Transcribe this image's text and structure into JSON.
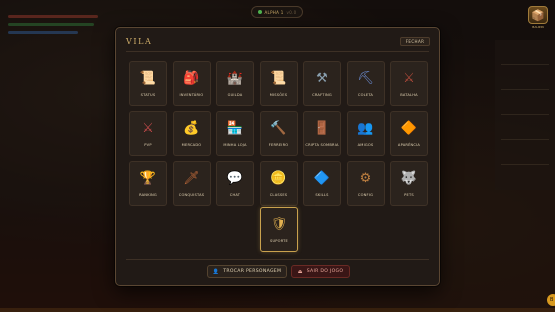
{
  "top_badge": {
    "label": "ALPHA 1",
    "version": "v0.0"
  },
  "top_right": {
    "label": "BAUZIN"
  },
  "modal": {
    "title": "VILA",
    "close_label": "FECHAR",
    "tiles": [
      {
        "label": "STATUS",
        "icon": "status-icon",
        "glyph": "📜",
        "color": "#d9a64a"
      },
      {
        "label": "INVENTÁRIO",
        "icon": "backpack-icon",
        "glyph": "🎒",
        "color": "#a8643a"
      },
      {
        "label": "GUILDA",
        "icon": "guild-icon",
        "glyph": "🏰",
        "color": "#c9a24e"
      },
      {
        "label": "MISSÕES",
        "icon": "scroll-icon",
        "glyph": "📜",
        "color": "#d8c08a"
      },
      {
        "label": "CRAFTING",
        "icon": "anvil-icon",
        "glyph": "⚒",
        "color": "#8aa0b0"
      },
      {
        "label": "COLETA",
        "icon": "pickaxe-icon",
        "glyph": "⛏",
        "color": "#6a8ad0"
      },
      {
        "label": "BATALHA",
        "icon": "battle-icon",
        "glyph": "⚔",
        "color": "#b04a3a"
      },
      {
        "label": "PVP",
        "icon": "pvp-swords-icon",
        "glyph": "⚔",
        "color": "#c44a4a"
      },
      {
        "label": "MERCADO",
        "icon": "market-icon",
        "glyph": "💰",
        "color": "#c9a24e"
      },
      {
        "label": "MINHA LOJA",
        "icon": "shop-icon",
        "glyph": "🏪",
        "color": "#a8643a"
      },
      {
        "label": "FERREIRO",
        "icon": "blacksmith-icon",
        "glyph": "🔨",
        "color": "#d87a30"
      },
      {
        "label": "CRIPTA SOMBRIA",
        "icon": "crypt-icon",
        "glyph": "🚪",
        "color": "#6a5a80"
      },
      {
        "label": "AMIGOS",
        "icon": "friends-icon",
        "glyph": "👥",
        "color": "#e0b050"
      },
      {
        "label": "APARÊNCIA",
        "icon": "appearance-icon",
        "glyph": "🔶",
        "color": "#e0a040"
      },
      {
        "label": "RANKING",
        "icon": "ranking-icon",
        "glyph": "🏆",
        "color": "#d9a64a"
      },
      {
        "label": "CONQUISTAS",
        "icon": "achievements-icon",
        "glyph": "🗡",
        "color": "#c06a3a"
      },
      {
        "label": "CHAT",
        "icon": "chat-icon",
        "glyph": "💬",
        "color": "#7ab0e0"
      },
      {
        "label": "CLASSES",
        "icon": "classes-icon",
        "glyph": "🪙",
        "color": "#e0b050"
      },
      {
        "label": "SKILLS",
        "icon": "skills-icon",
        "glyph": "🔷",
        "color": "#50a0e0"
      },
      {
        "label": "CONFIG",
        "icon": "gear-icon",
        "glyph": "⚙",
        "color": "#c08040"
      },
      {
        "label": "PETS",
        "icon": "pets-icon",
        "glyph": "🐺",
        "color": "#a0a0a0"
      }
    ],
    "support_tile": {
      "label": "SUPORTE",
      "icon": "support-icon",
      "glyph": "🛡",
      "color": "#e0b050"
    },
    "switch_character_label": "TROCAR PERSONAGEM",
    "logout_label": "SAIR DO JOGO"
  },
  "colors": {
    "accent": "#cfae6a",
    "panel": "#211a16",
    "tile": "#2b231d",
    "danger": "#3a1616"
  }
}
